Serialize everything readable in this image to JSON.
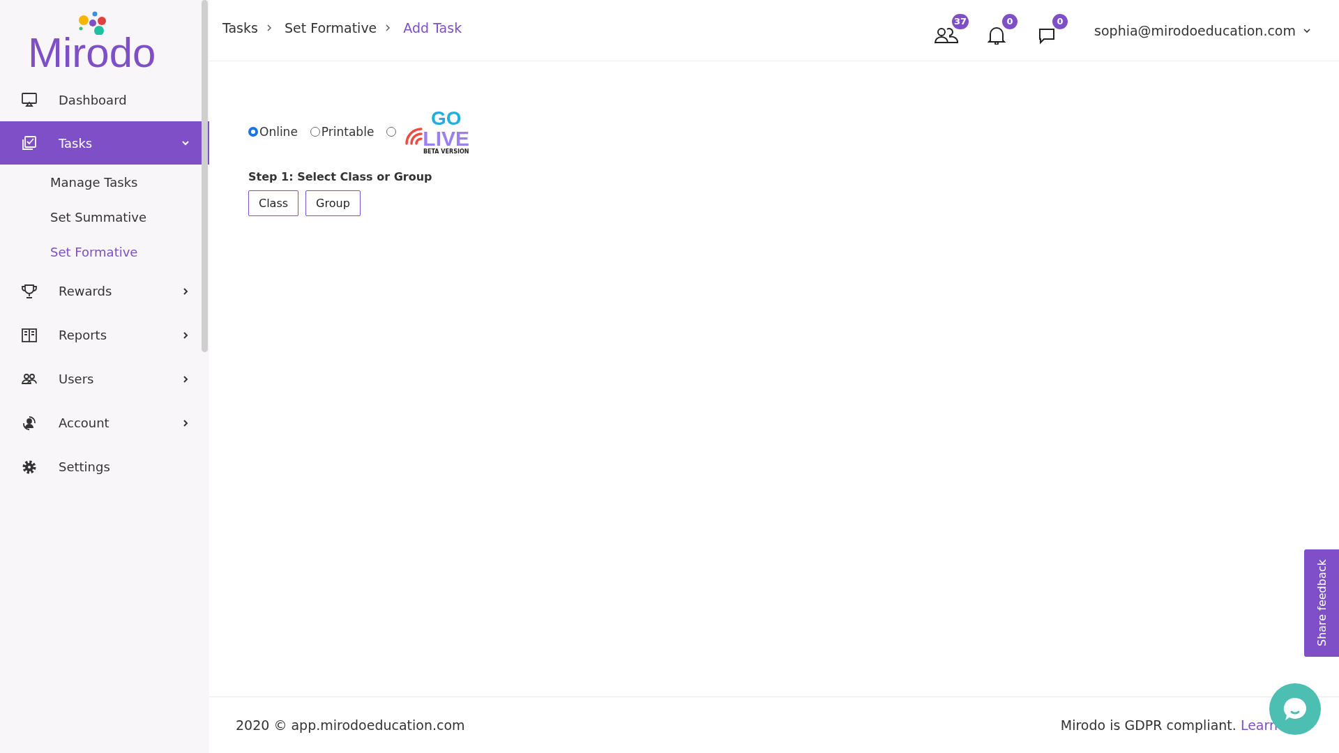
{
  "logo": {
    "text": "Mirodo"
  },
  "sidebar": {
    "items": [
      {
        "label": "Dashboard",
        "kind": "link",
        "selected": false
      },
      {
        "label": "Tasks",
        "kind": "expandable",
        "selected": true,
        "expanded": true,
        "children": [
          {
            "label": "Manage Tasks",
            "selected": false
          },
          {
            "label": "Set Summative",
            "selected": false
          },
          {
            "label": "Set Formative",
            "selected": true
          }
        ]
      },
      {
        "label": "Rewards",
        "kind": "expandable",
        "selected": false,
        "expanded": false
      },
      {
        "label": "Reports",
        "kind": "expandable",
        "selected": false,
        "expanded": false
      },
      {
        "label": "Users",
        "kind": "expandable",
        "selected": false,
        "expanded": false
      },
      {
        "label": "Account",
        "kind": "expandable",
        "selected": false,
        "expanded": false
      },
      {
        "label": "Settings",
        "kind": "link",
        "selected": false
      }
    ]
  },
  "breadcrumb": [
    {
      "label": "Tasks",
      "current": false
    },
    {
      "label": "Set Formative",
      "current": false
    },
    {
      "label": "Add Task",
      "current": true
    }
  ],
  "header": {
    "icons": [
      {
        "badge": "37"
      },
      {
        "badge": "0"
      },
      {
        "badge": "0"
      }
    ],
    "user_email": "sophia@mirodoeducation.com"
  },
  "task_type": [
    {
      "kind": "text",
      "label": "Online",
      "selected": true
    },
    {
      "kind": "text",
      "label": "Printable",
      "selected": false
    },
    {
      "kind": "logo",
      "go": "GO",
      "live": "LIVE",
      "beta": "BETA VERSION",
      "selected": false
    }
  ],
  "step": {
    "label": "Step 1: Select Class or Group",
    "buttons": [
      "Class",
      "Group"
    ]
  },
  "footer": {
    "copyright": "2020 © app.mirodoeducation.com",
    "gdpr": "Mirodo is GDPR compliant.",
    "link": "Learn"
  },
  "feedback_tab": "Share feedback"
}
